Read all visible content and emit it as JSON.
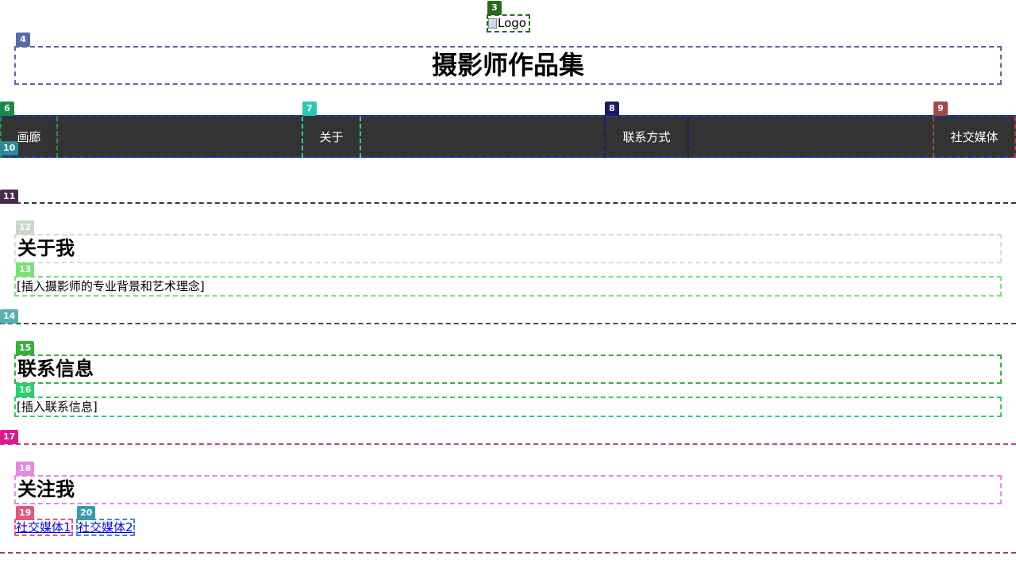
{
  "header": {
    "logo_alt": "Logo",
    "site_title": "摄影师作品集"
  },
  "nav": {
    "items": [
      {
        "label": "画廊"
      },
      {
        "label": "关于"
      },
      {
        "label": "联系方式"
      },
      {
        "label": "社交媒体"
      }
    ]
  },
  "about": {
    "heading": "关于我",
    "text": "[插入摄影师的专业背景和艺术理念]"
  },
  "contact": {
    "heading": "联系信息",
    "text": "[插入联系信息]"
  },
  "social": {
    "heading": "关注我",
    "links": [
      {
        "label": "社交媒体1"
      },
      {
        "label": "社交媒体2"
      }
    ]
  },
  "annotation_tags": [
    "3",
    "4",
    "6",
    "7",
    "8",
    "9",
    "10",
    "11",
    "12",
    "13",
    "14",
    "15",
    "16",
    "17",
    "18",
    "19",
    "20"
  ],
  "colors": {
    "nav_background": "#333333",
    "nav_text": "#ffffff",
    "link": "#0000ee"
  }
}
